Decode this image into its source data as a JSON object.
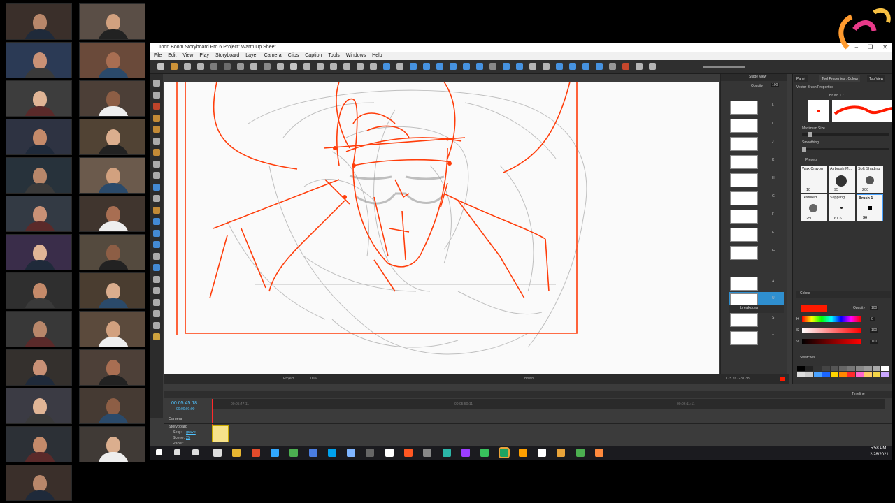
{
  "window": {
    "title": "Toon Boom Storyboard Pro 6 Project: Warm Up Sheet",
    "minimize": "–",
    "restore": "❐",
    "close": "✕"
  },
  "menu": [
    "File",
    "Edit",
    "View",
    "Play",
    "Storyboard",
    "Layer",
    "Camera",
    "Clips",
    "Caption",
    "Tools",
    "Windows",
    "Help"
  ],
  "stage_view": {
    "title": "Stage View",
    "opacity_label": "Opacity",
    "opacity_value": "100"
  },
  "stage_status": {
    "project": "Project",
    "zoom": "16%",
    "tool": "Brush",
    "coords": "175.76 -231.38"
  },
  "layers": {
    "rows": [
      "L",
      "I",
      "J",
      "K",
      "H",
      "G",
      "F",
      "E",
      "G",
      "A",
      "U",
      "S",
      "T"
    ],
    "group_label": "breakdown"
  },
  "tool_properties": {
    "tabs": [
      "Panel",
      "Tool Properties : Colour",
      "Top View"
    ],
    "section": "Vector Brush Properties",
    "brush_name": "Brush 1 *",
    "max_size_label": "Maximum Size",
    "smoothing_label": "Smoothing",
    "presets_label": "Presets",
    "presets": [
      {
        "name": "Wax Crayon",
        "value": "10"
      },
      {
        "name": "Airbrush M...",
        "value": "95"
      },
      {
        "name": "Soft Shading",
        "value": "200"
      },
      {
        "name": "Textured ...",
        "value": "250"
      },
      {
        "name": "Stippling",
        "value": "61.6"
      },
      {
        "name": "Brush 1",
        "value": "30"
      }
    ]
  },
  "colour": {
    "title": "Colour",
    "opacity_label": "Opacity",
    "opacity_value": "100",
    "current": "#ff1a00",
    "h_label": "H",
    "s_label": "S",
    "v_label": "V",
    "h_value": "0",
    "s_value": "100",
    "v_value": "100"
  },
  "swatches": {
    "title": "Swatches",
    "colors": [
      "#000000",
      "#222222",
      "#333333",
      "#444444",
      "#555555",
      "#666666",
      "#777777",
      "#888888",
      "#999999",
      "#aaaaaa",
      "#ffffff",
      "#dddddd",
      "#cccccc",
      "#4aa3ff",
      "#1a66ff",
      "#ffd400",
      "#ff8800",
      "#ff2a2a",
      "#ff66cc",
      "#ffcc66",
      "#f5d547",
      "#c9a7ff"
    ]
  },
  "timeline": {
    "title": "Timeline",
    "current_time": "00:05:45:18",
    "duration": "00:00:01:00",
    "marks": [
      "00:05:47:11",
      "00:05:50:11",
      "00:06:11:11"
    ],
    "camera_label": "Camera",
    "storyboard_label": "Storyboard",
    "seq_label": "Seq.:",
    "seq_value": "grave",
    "scene_label": "Scene:",
    "scene_value": "25",
    "panel_label": "Panel:"
  },
  "taskbar": {
    "time": "5:58 PM",
    "date": "2/28/2021",
    "icon_colors": [
      "#dddddd",
      "#e8b631",
      "#e24b2b",
      "#31a8ff",
      "#4caf50",
      "#4a7de0",
      "#00a2ed",
      "#7fb5ff",
      "#666666",
      "#ffffff",
      "#ff5722",
      "#888888",
      "#2bb6a8",
      "#9c3dff",
      "#38c25c",
      "#1ea362",
      "#ffa000",
      "#ffffff",
      "#e8a33a",
      "#4caf50",
      "#ff8a3d"
    ]
  }
}
